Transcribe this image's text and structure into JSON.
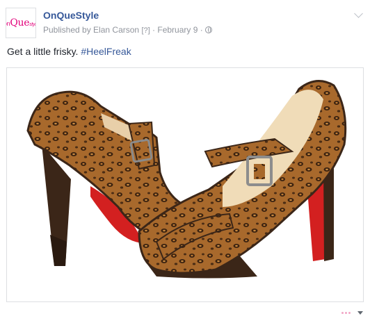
{
  "post": {
    "page_name": "OnQueStyle",
    "avatar_logo": {
      "part1": "on",
      "part2": "Que",
      "part3": "style"
    },
    "published_by": "Published by Elan Carson",
    "help_marker": "[?]",
    "separator": "·",
    "date": "February 9",
    "message_text": "Get a little frisky.",
    "hashtag": "#HeelFreak",
    "photo_subject": "leopard print Mary Jane high heels with red soles"
  },
  "colors": {
    "link": "#365899",
    "meta": "#90949c",
    "text": "#1d2129",
    "leopard_base": "#a8692c",
    "sole_red": "#d32020",
    "heel_brown": "#3b2618"
  }
}
